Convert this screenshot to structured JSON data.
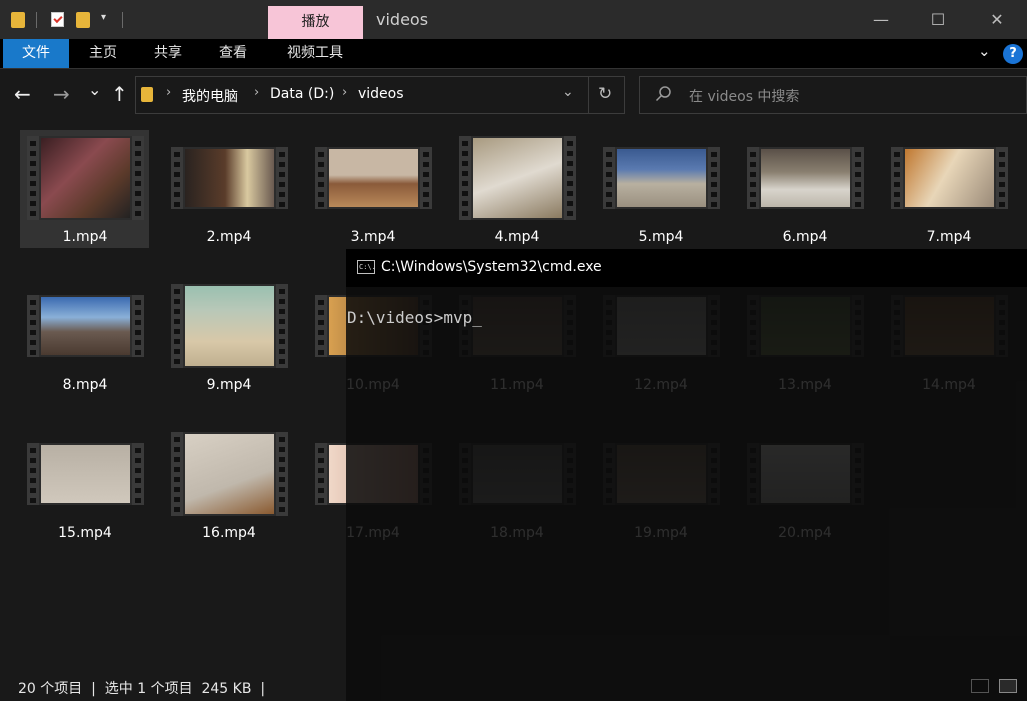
{
  "window": {
    "title": "videos",
    "context_tab": "播放",
    "controls": {
      "minimize": "—",
      "maximize": "☐",
      "close": "✕"
    }
  },
  "ribbon": {
    "tabs": [
      "文件",
      "主页",
      "共享",
      "查看",
      "视频工具"
    ],
    "help": "?"
  },
  "nav": {
    "back": "←",
    "forward": "→",
    "recent": "⌄",
    "up": "↑",
    "breadcrumbs": [
      "我的电脑",
      "Data (D:)",
      "videos"
    ],
    "search_placeholder": "在 videos 中搜索"
  },
  "files": [
    {
      "name": "1.mp4",
      "selected": true
    },
    {
      "name": "2.mp4"
    },
    {
      "name": "3.mp4"
    },
    {
      "name": "4.mp4"
    },
    {
      "name": "5.mp4"
    },
    {
      "name": "6.mp4"
    },
    {
      "name": "7.mp4"
    },
    {
      "name": "8.mp4"
    },
    {
      "name": "9.mp4"
    },
    {
      "name": "10.mp4"
    },
    {
      "name": "11.mp4"
    },
    {
      "name": "12.mp4"
    },
    {
      "name": "13.mp4"
    },
    {
      "name": "14.mp4"
    },
    {
      "name": "15.mp4"
    },
    {
      "name": "16.mp4"
    },
    {
      "name": "17.mp4"
    },
    {
      "name": "18.mp4"
    },
    {
      "name": "19.mp4"
    },
    {
      "name": "20.mp4"
    }
  ],
  "console": {
    "title": "C:\\Windows\\System32\\cmd.exe",
    "icon_text": "C:\\.",
    "line": "D:\\videos>mvp_"
  },
  "status": {
    "text": "20 个项目  |  选中 1 个项目  245 KB  |"
  },
  "colors": {
    "accent": "#1979ca",
    "context_tab": "#f7c5d7",
    "folder": "#e7b53a"
  }
}
